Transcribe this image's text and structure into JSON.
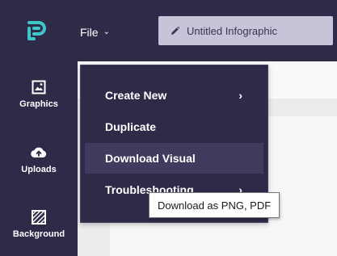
{
  "header": {
    "logo_icon": "piktochart-logo-icon",
    "file_menu_label": "File",
    "file_menu_chevron": "⌄",
    "title_value": "Untitled Infographic",
    "title_icon": "pencil-icon"
  },
  "sidebar": {
    "items": [
      {
        "label": "Graphics",
        "icon": "image-icon"
      },
      {
        "label": "Uploads",
        "icon": "cloud-upload-icon"
      },
      {
        "label": "Background",
        "icon": "hatched-square-icon"
      }
    ]
  },
  "file_dropdown": {
    "items": [
      {
        "label": "Create New",
        "has_submenu": true,
        "arrow": "›"
      },
      {
        "label": "Duplicate",
        "has_submenu": false
      },
      {
        "label": "Download Visual",
        "has_submenu": false,
        "highlighted": true
      },
      {
        "label": "Troubleshooting",
        "has_submenu": true,
        "arrow": "›"
      }
    ]
  },
  "tooltip": {
    "text": "Download as PNG, PDF"
  },
  "colors": {
    "nav_bg": "#2e2b49",
    "logo_accent": "#3fc6c9",
    "title_field_bg": "#c9c3da",
    "dropdown_highlight": "#403c5d"
  }
}
